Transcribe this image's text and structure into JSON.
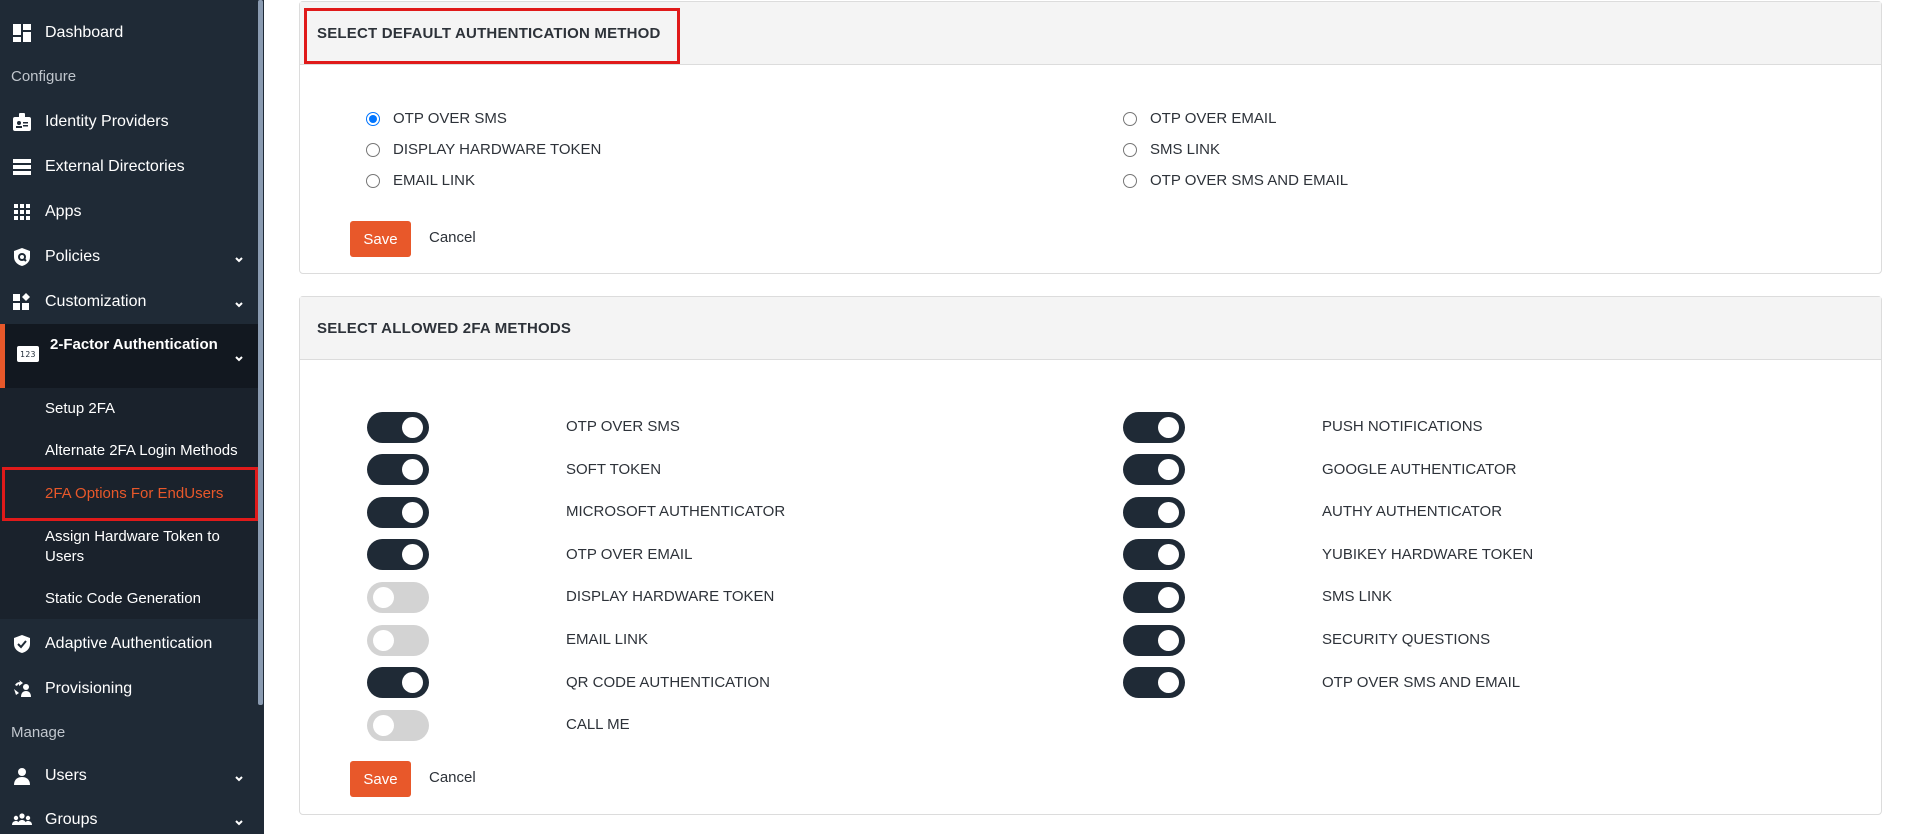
{
  "sidebar": {
    "items": [
      {
        "label": "Dashboard",
        "icon": "dashboard-icon"
      },
      {
        "label": "Identity Providers",
        "icon": "id-badge-icon"
      },
      {
        "label": "External Directories",
        "icon": "server-stack-icon"
      },
      {
        "label": "Apps",
        "icon": "grid-icon"
      },
      {
        "label": "Policies",
        "icon": "shield-search-icon",
        "expandable": true
      },
      {
        "label": "Customization",
        "icon": "widgets-icon",
        "expandable": true
      },
      {
        "label": "Adaptive Authentication",
        "icon": "shield-check-icon"
      },
      {
        "label": "Provisioning",
        "icon": "provisioning-icon"
      },
      {
        "label": "Users",
        "icon": "user-icon",
        "expandable": true
      },
      {
        "label": "Groups",
        "icon": "groups-icon",
        "expandable": true
      }
    ],
    "sections": {
      "configure": "Configure",
      "manage": "Manage"
    },
    "active_group": {
      "label": "2-Factor Authentication",
      "icon_text": "123",
      "subitems": [
        {
          "label": "Setup 2FA"
        },
        {
          "label": "Alternate 2FA Login Methods"
        },
        {
          "label": "2FA Options For EndUsers",
          "current": true
        },
        {
          "label": "Assign Hardware Token to Users"
        },
        {
          "label": "Static Code Generation"
        }
      ]
    }
  },
  "default_method": {
    "title": "SELECT DEFAULT AUTHENTICATION METHOD",
    "options_left": [
      {
        "label": "OTP OVER SMS",
        "checked": true
      },
      {
        "label": "DISPLAY HARDWARE TOKEN",
        "checked": false
      },
      {
        "label": "EMAIL LINK",
        "checked": false
      }
    ],
    "options_right": [
      {
        "label": "OTP OVER EMAIL",
        "checked": false
      },
      {
        "label": "SMS LINK",
        "checked": false
      },
      {
        "label": "OTP OVER SMS AND EMAIL",
        "checked": false
      }
    ],
    "save_label": "Save",
    "cancel_label": "Cancel"
  },
  "allowed_methods": {
    "title": "SELECT ALLOWED 2FA METHODS",
    "left": [
      {
        "label": "OTP OVER SMS",
        "enabled": true
      },
      {
        "label": "SOFT TOKEN",
        "enabled": true
      },
      {
        "label": "MICROSOFT AUTHENTICATOR",
        "enabled": true
      },
      {
        "label": "OTP OVER EMAIL",
        "enabled": true
      },
      {
        "label": "DISPLAY HARDWARE TOKEN",
        "enabled": false
      },
      {
        "label": "EMAIL LINK",
        "enabled": false
      },
      {
        "label": "QR CODE AUTHENTICATION",
        "enabled": true
      },
      {
        "label": "CALL ME",
        "enabled": false
      }
    ],
    "right": [
      {
        "label": "PUSH NOTIFICATIONS",
        "enabled": true
      },
      {
        "label": "GOOGLE AUTHENTICATOR",
        "enabled": true
      },
      {
        "label": "AUTHY AUTHENTICATOR",
        "enabled": true
      },
      {
        "label": "YUBIKEY HARDWARE TOKEN",
        "enabled": true
      },
      {
        "label": "SMS LINK",
        "enabled": true
      },
      {
        "label": "SECURITY QUESTIONS",
        "enabled": true
      },
      {
        "label": "OTP OVER SMS AND EMAIL",
        "enabled": true
      }
    ],
    "save_label": "Save",
    "cancel_label": "Cancel"
  },
  "colors": {
    "accent": "#e8582a",
    "sidebar_bg": "#1f2a36",
    "toggle_on": "#1f2a36",
    "toggle_off": "#d3d3d3",
    "radio_checked": "#0075ff",
    "highlight_border": "#e01a1a"
  }
}
